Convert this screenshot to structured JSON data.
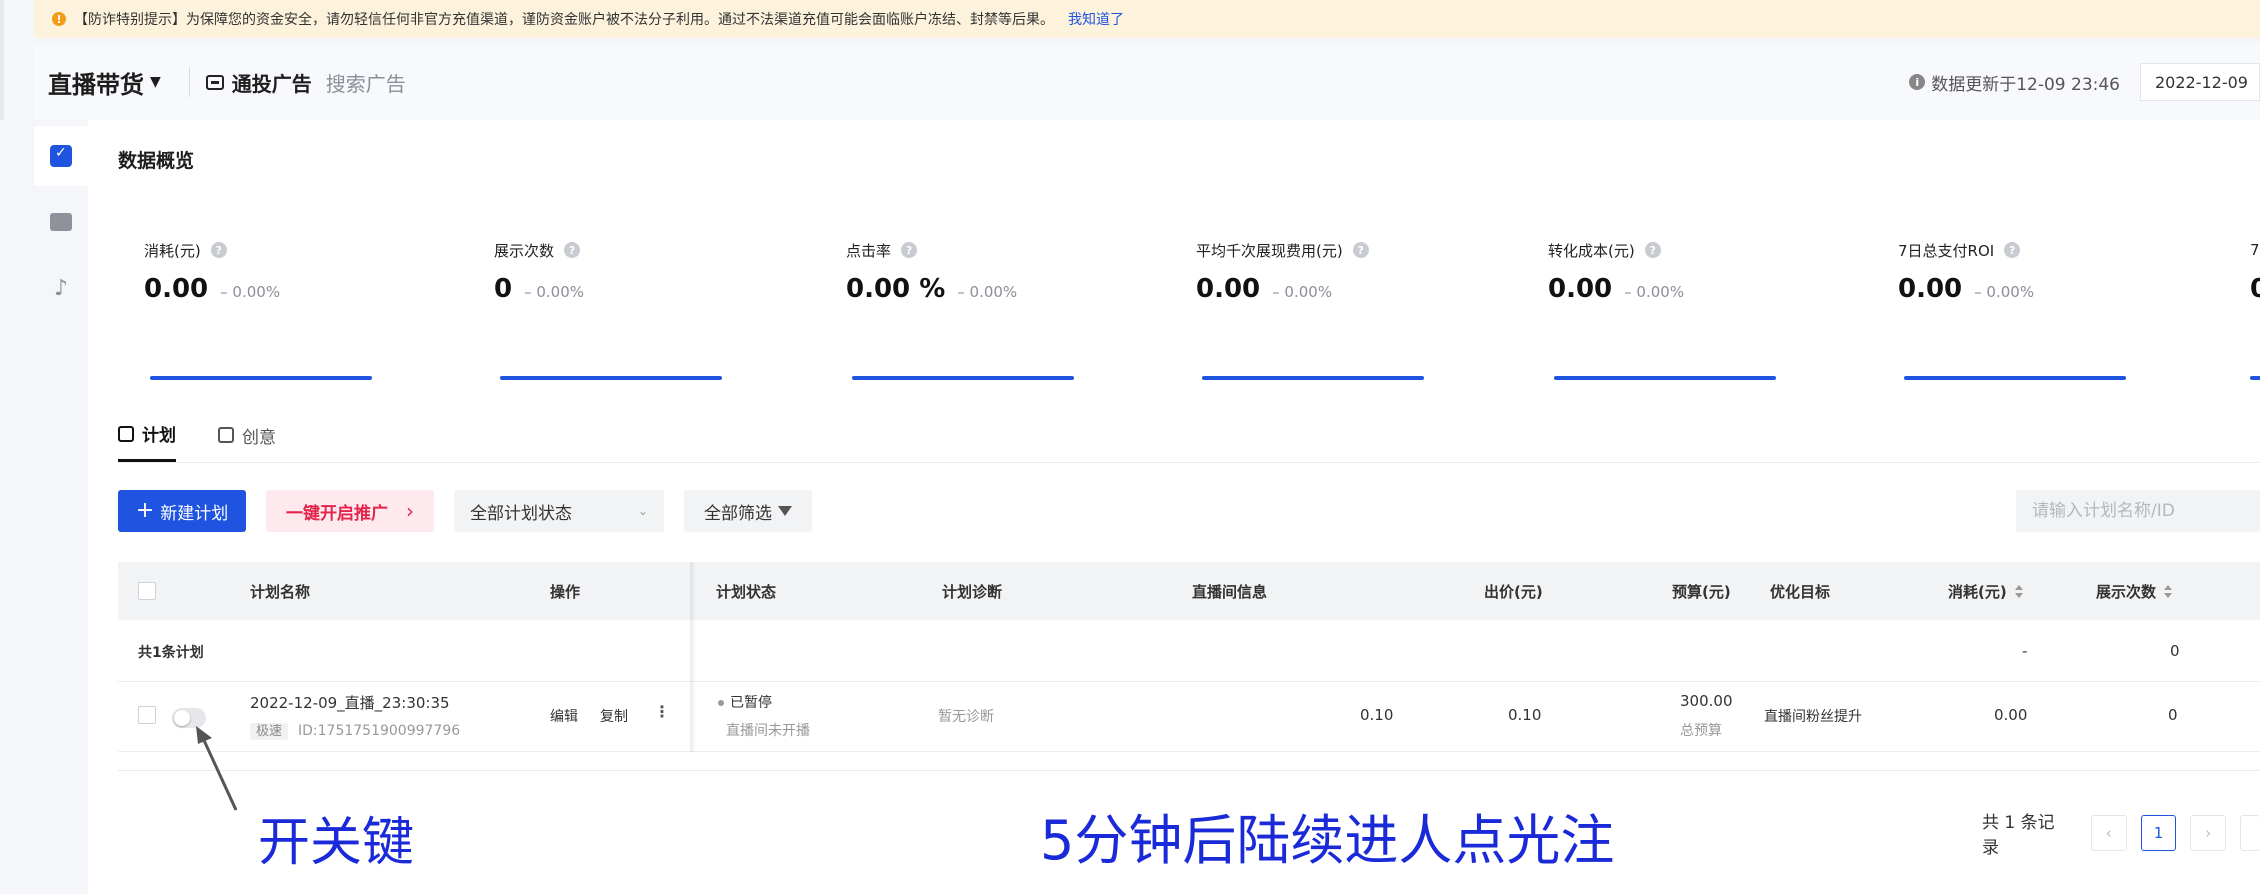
{
  "banner": {
    "text": "【防诈特别提示】为保障您的资金安全，请勿轻信任何非官方充值渠道，谨防资金账户被不法分子利用。通过不法渠道充值可能会面临账户冻结、封禁等后果。",
    "link": "我知道了",
    "icon": "warning-icon",
    "color": "#fdf3dd"
  },
  "header": {
    "brand": "直播带货",
    "tabs": [
      "通投广告",
      "搜索广告"
    ],
    "update_text": "数据更新于12-09 23:46",
    "date_value": "2022-12-09"
  },
  "rail": {
    "icons": [
      "calendar-check-icon",
      "folder-icon",
      "tiktok-icon"
    ]
  },
  "overview": {
    "title": "数据概览",
    "metrics": [
      {
        "label": "消耗(元)",
        "value": "0.00",
        "change": "– 0.00%"
      },
      {
        "label": "展示次数",
        "value": "0",
        "change": "– 0.00%"
      },
      {
        "label": "点击率",
        "value": "0.00 %",
        "change": "– 0.00%"
      },
      {
        "label": "平均千次展现费用(元)",
        "value": "0.00",
        "change": "– 0.00%"
      },
      {
        "label": "转化成本(元)",
        "value": "0.00",
        "change": "– 0.00%"
      },
      {
        "label": "7日总支付ROI",
        "value": "0.00",
        "change": "– 0.00%"
      },
      {
        "label": "7",
        "value": "0",
        "change": ""
      }
    ],
    "accent_color": "#1f54e0"
  },
  "tabs": {
    "plan": "计划",
    "creative": "创意"
  },
  "toolbar": {
    "new_plan": "新建计划",
    "one_click": "一键开启推广",
    "status_select": "全部计划状态",
    "filter": "全部筛选",
    "search_placeholder": "请输入计划名称/ID"
  },
  "table": {
    "headers": {
      "name": "计划名称",
      "ops": "操作",
      "status": "计划状态",
      "diagnosis": "计划诊断",
      "live_info": "直播间信息",
      "bid": "出价(元)",
      "budget": "预算(元)",
      "goal": "优化目标",
      "cost": "消耗(元)",
      "impressions": "展示次数"
    },
    "summary": {
      "label": "共1条计划",
      "cost": "-",
      "impressions": "0"
    },
    "rows": [
      {
        "name": "2022-12-09_直播_23:30:35",
        "tag": "极速",
        "id": "ID:1751751900997796",
        "edit": "编辑",
        "copy": "复制",
        "status": "已暂停",
        "status_sub": "直播间未开播",
        "diagnosis": "暂无诊断",
        "live_val": "0.10",
        "bid": "0.10",
        "budget": "300.00",
        "budget_sub": "总预算",
        "goal": "直播间粉丝提升",
        "cost": "0.00",
        "impressions": "0"
      }
    ]
  },
  "pagination": {
    "total": "共 1 条记录",
    "current": "1"
  },
  "annotations": {
    "left": "开关键",
    "center": "5分钟后陆续进人点光注",
    "color": "#1a2ad9"
  }
}
